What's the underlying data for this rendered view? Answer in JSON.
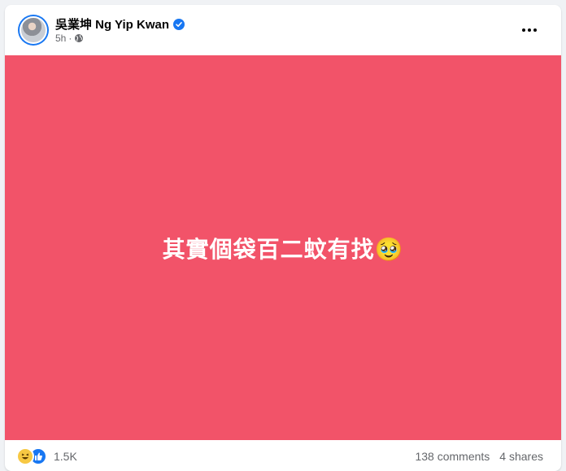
{
  "post": {
    "author": "吳業坤 Ng Yip Kwan",
    "time": "5h",
    "text": "其實個袋百二蚊有找🥹",
    "background_color": "#f25369",
    "text_color": "#ffffff"
  },
  "header": {
    "more_icon": "more-horizontal-icon",
    "privacy_icon": "globe-icon",
    "verified_icon": "verified-badge-icon"
  },
  "footer": {
    "reaction_icons": [
      "haha-reaction-icon",
      "like-reaction-icon"
    ],
    "reactions_count": "1.5K",
    "comments": "138 comments",
    "shares": "4 shares"
  },
  "colors": {
    "page_bg": "#f0f2f5",
    "brand_blue": "#1877f2",
    "secondary_text": "#65676b"
  }
}
